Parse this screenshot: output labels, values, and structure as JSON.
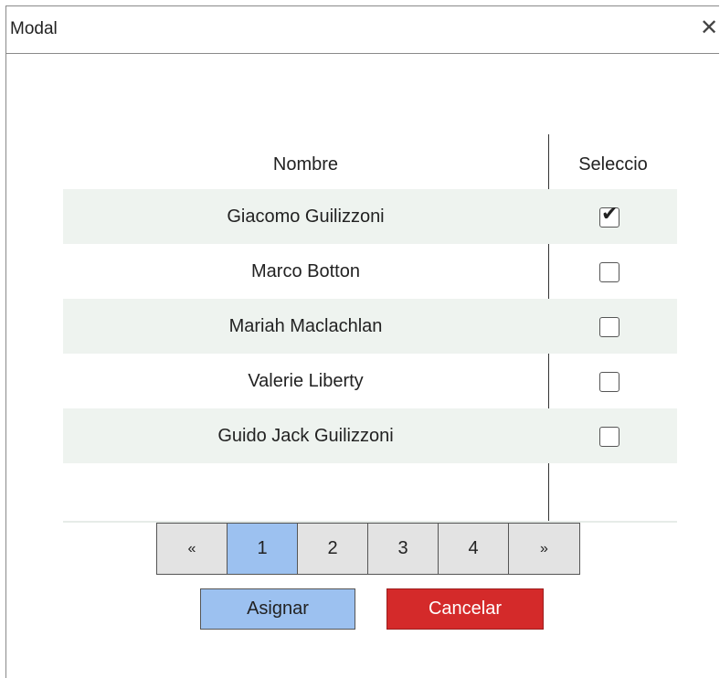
{
  "modal": {
    "title": "Modal",
    "close_icon": "close-icon"
  },
  "table": {
    "headers": [
      "Nombre",
      "Seleccio"
    ],
    "rows": [
      {
        "name": "Giacomo Guilizzoni",
        "selected": true
      },
      {
        "name": "Marco Botton",
        "selected": false
      },
      {
        "name": "Mariah Maclachlan",
        "selected": false
      },
      {
        "name": "Valerie Liberty",
        "selected": false
      },
      {
        "name": "Guido Jack Guilizzoni",
        "selected": false
      }
    ]
  },
  "pagination": {
    "prev": "«",
    "pages": [
      "1",
      "2",
      "3",
      "4"
    ],
    "current": "1",
    "next": "»"
  },
  "actions": {
    "assign_label": "Asignar",
    "cancel_label": "Cancelar"
  },
  "colors": {
    "row_alt": "#eef3ef",
    "primary": "#9cc1f0",
    "danger": "#d42a2a"
  }
}
